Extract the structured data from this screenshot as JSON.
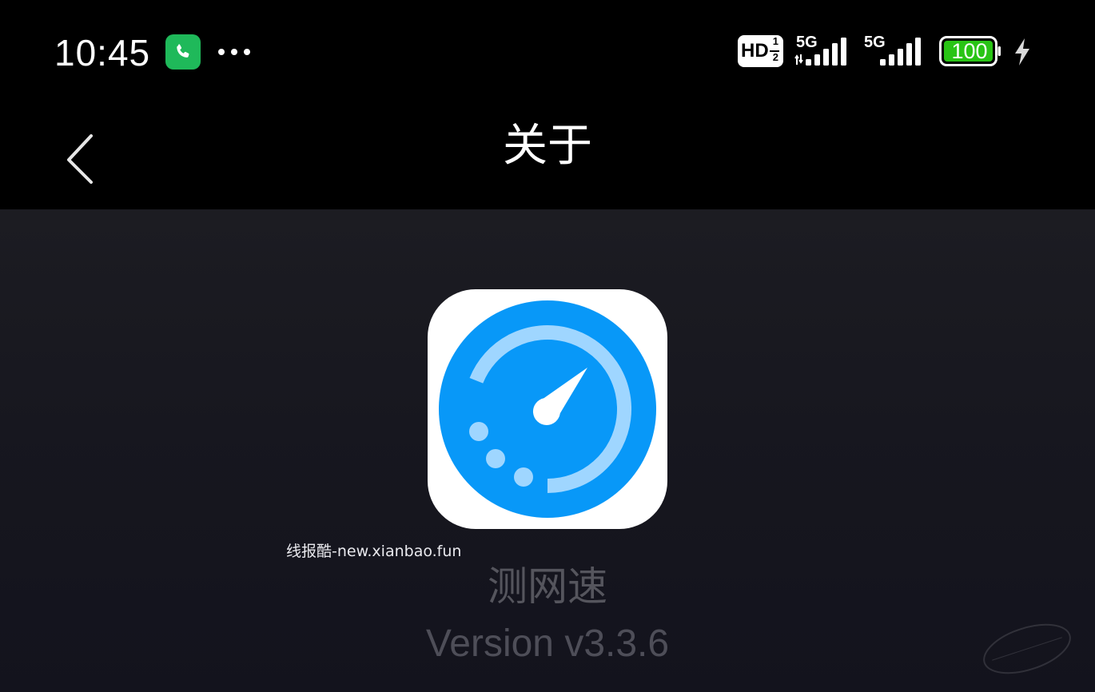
{
  "status_bar": {
    "time": "10:45",
    "hd_label": "HD",
    "hd_sup": "1",
    "hd_sub": "2",
    "sim1_network": "5G",
    "sim2_network": "5G",
    "battery_level": "100",
    "icons": [
      "phone-call-icon",
      "more-dots-icon",
      "hd-voice-icon",
      "signal-icon",
      "battery-icon",
      "charging-bolt-icon"
    ]
  },
  "title_bar": {
    "title": "关于"
  },
  "app": {
    "name": "测网速",
    "version": "Version v3.3.6",
    "icon": "speedometer-icon"
  },
  "watermark": "线报酷-new.xianbao.fun",
  "colors": {
    "background_top": "#000000",
    "content_bg": "#17171f",
    "icon_blue": "#0898f8",
    "icon_light_blue": "#9fd6ff",
    "call_green": "#1fb95a",
    "battery_green": "#29c415"
  }
}
